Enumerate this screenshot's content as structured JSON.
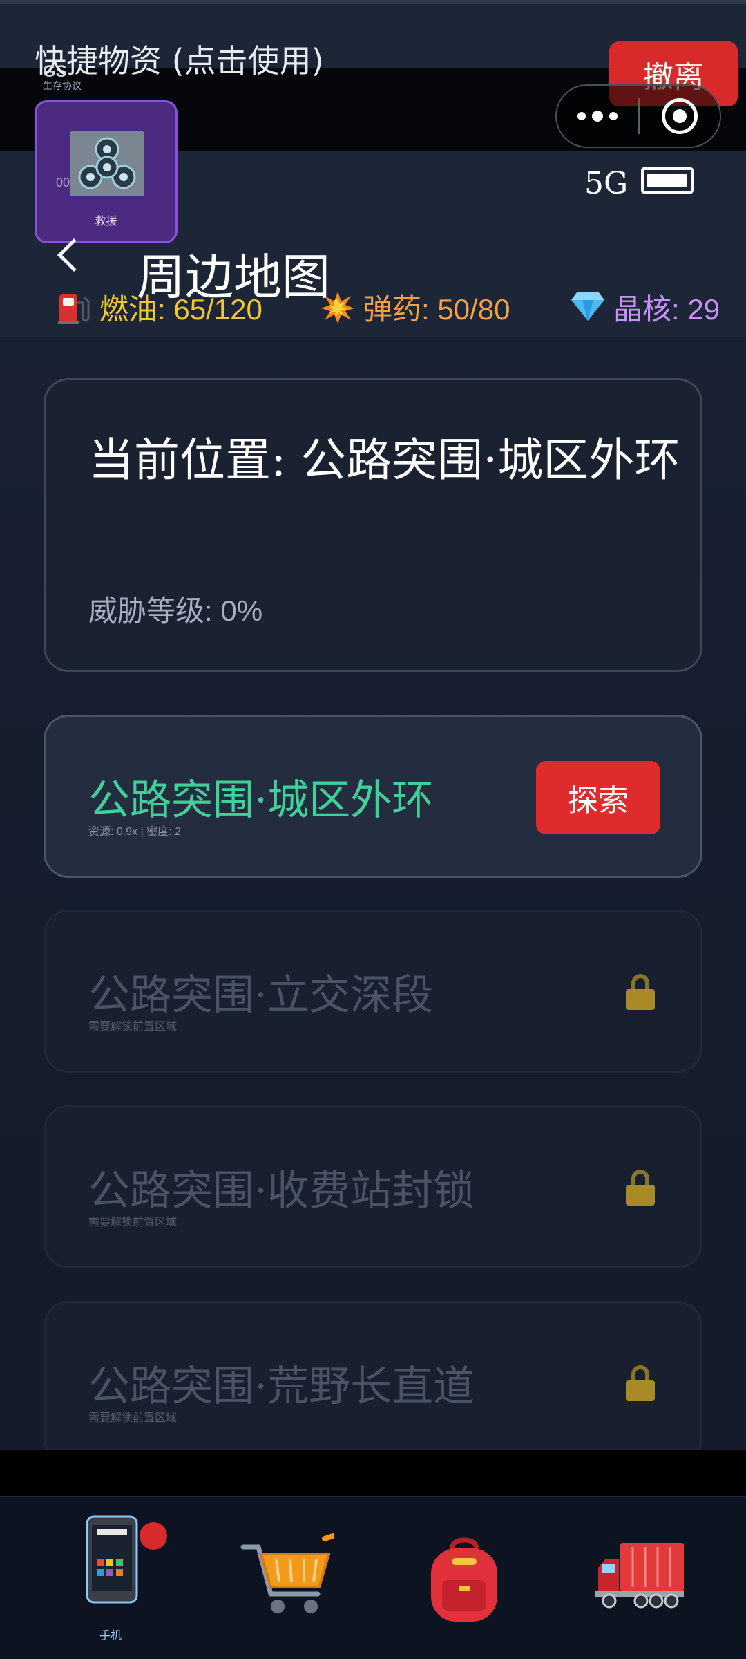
{
  "header": {
    "quick_supplies": "快捷物资 (点击使用)",
    "app_logo": "GS",
    "app_subtitle": "生存协议",
    "evacuate_label": "撤离",
    "rescue_item": {
      "count": "00",
      "label": "救援"
    },
    "network": "5G",
    "back_icon": "chevron-left-icon",
    "title": "周边地图"
  },
  "stats": {
    "fuel": {
      "icon": "fuel-pump-icon",
      "text": "燃油: 65/120",
      "color": "#f2c832"
    },
    "ammo": {
      "icon": "explosion-icon",
      "text": "弹药: 50/80",
      "color": "#f4a24a"
    },
    "core": {
      "icon": "gem-icon",
      "text": "晶核: 29",
      "color": "#c792f5"
    }
  },
  "location": {
    "title": "当前位置: 公路突围·城区外环",
    "threat": "威胁等级: 0%"
  },
  "areas": [
    {
      "name": "公路突围·城区外环",
      "meta": "资源: 0.9x | 密度: 2",
      "action": "探索",
      "unlocked": true,
      "color": "#3fd19a"
    },
    {
      "name": "公路突围·立交深段",
      "meta": "需要解锁前置区域",
      "unlocked": false
    },
    {
      "name": "公路突围·收费站封锁",
      "meta": "需要解锁前置区域",
      "unlocked": false
    },
    {
      "name": "公路突围·荒野长直道",
      "meta": "需要解锁前置区域",
      "unlocked": false
    }
  ],
  "bottom_nav": [
    {
      "icon": "phone-icon",
      "label": "手机",
      "badge": true
    },
    {
      "icon": "shopping-cart-icon",
      "label": ""
    },
    {
      "icon": "backpack-icon",
      "label": ""
    },
    {
      "icon": "truck-icon",
      "label": ""
    }
  ]
}
